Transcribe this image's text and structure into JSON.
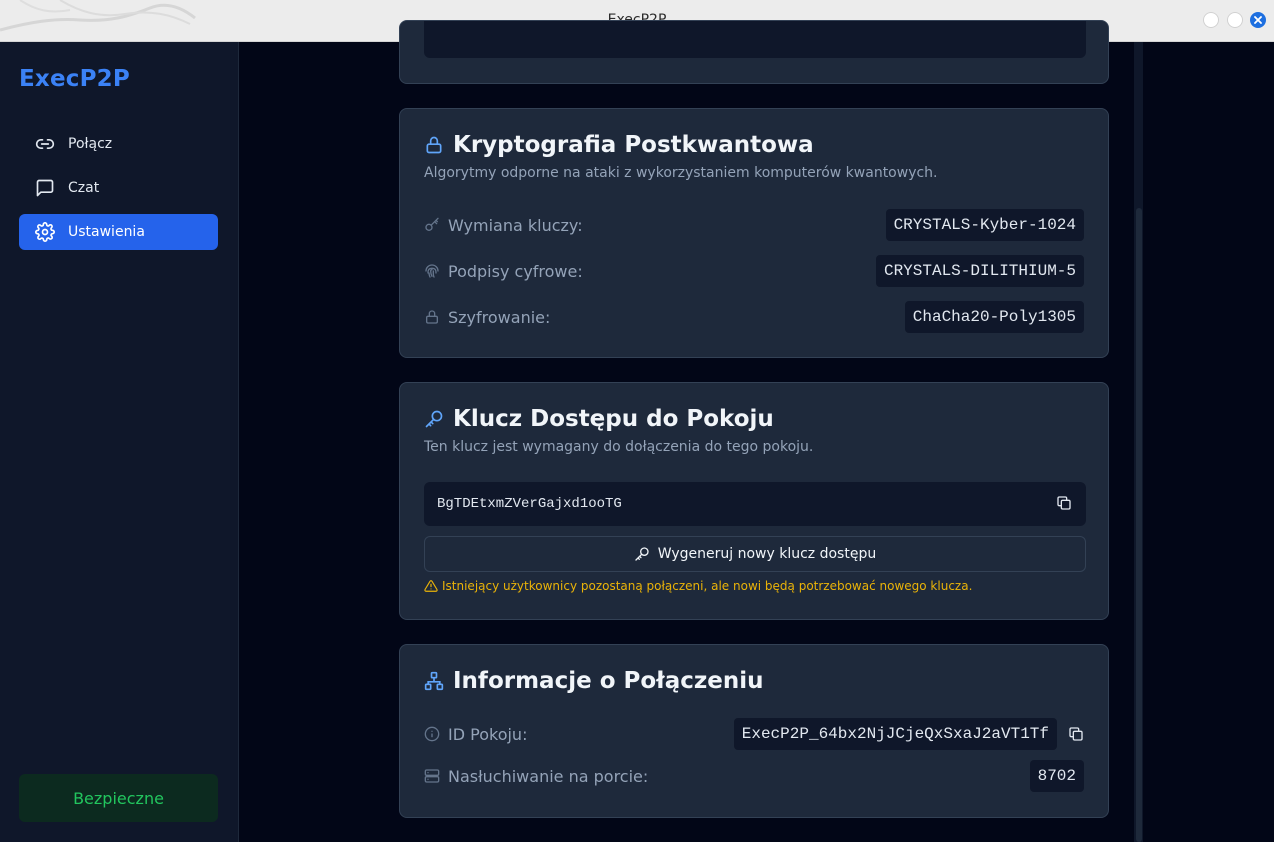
{
  "window": {
    "title": "ExecP2P"
  },
  "sidebar": {
    "brand": "ExecP2P",
    "items": [
      {
        "label": "Połącz",
        "icon": "link-icon"
      },
      {
        "label": "Czat",
        "icon": "chat-icon"
      },
      {
        "label": "Ustawienia",
        "icon": "gear-icon",
        "active": true
      }
    ],
    "status": "Bezpieczne"
  },
  "crypto": {
    "title": "Kryptografia Postkwantowa",
    "description": "Algorytmy odporne na ataki z wykorzystaniem komputerów kwantowych.",
    "rows": [
      {
        "label": "Wymiana kluczy:",
        "value": "CRYSTALS-Kyber-1024",
        "icon": "key-icon"
      },
      {
        "label": "Podpisy cyfrowe:",
        "value": "CRYSTALS-DILITHIUM-5",
        "icon": "fingerprint-icon"
      },
      {
        "label": "Szyfrowanie:",
        "value": "ChaCha20-Poly1305",
        "icon": "lock-icon"
      }
    ]
  },
  "access_key": {
    "title": "Klucz Dostępu do Pokoju",
    "description": "Ten klucz jest wymagany do dołączenia do tego pokoju.",
    "value": "BgTDEtxmZVerGajxd1ooTG",
    "regenerate_label": "Wygeneruj nowy klucz dostępu",
    "warning": "Istniejący użytkownicy pozostaną połączeni, ale nowi będą potrzebować nowego klucza."
  },
  "connection": {
    "title": "Informacje o Połączeniu",
    "room_id_label": "ID Pokoju:",
    "room_id": "ExecP2P_64bx2NjJCjeQxSxaJ2aVT1Tf",
    "port_label": "Nasłuchiwanie na porcie:",
    "port": "8702"
  },
  "colors": {
    "accent": "#2563eb",
    "brand": "#3b82f6",
    "secure": "#22c55e",
    "warning": "#eab308"
  }
}
